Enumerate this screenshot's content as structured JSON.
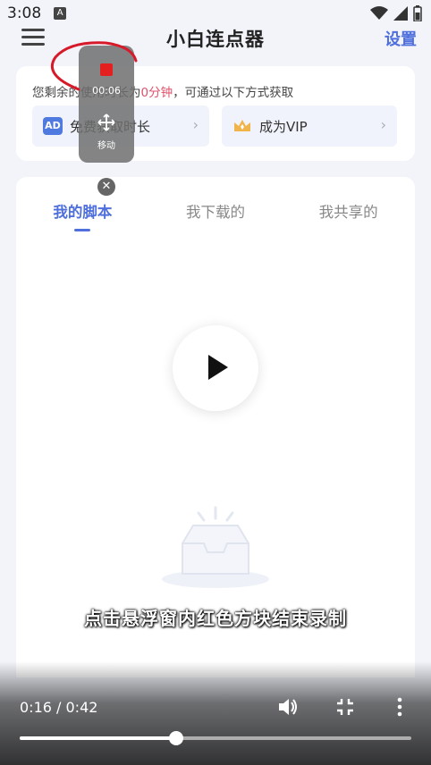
{
  "status_bar": {
    "time": "3:08",
    "a_badge": "A"
  },
  "header": {
    "title": "小白连点器",
    "settings_label": "设置"
  },
  "quota": {
    "text_prefix": "您剩余的使用时长为",
    "text_highlight": "0分钟",
    "text_suffix": "，可通过以下方式获取",
    "ad_badge": "AD",
    "ad_option": "免费获取时长",
    "vip_option": "成为VIP",
    "chevron": "›"
  },
  "tabs": [
    {
      "label": "我的脚本",
      "active": true
    },
    {
      "label": "我下载的",
      "active": false
    },
    {
      "label": "我共享的",
      "active": false
    }
  ],
  "floating_panel": {
    "timer": "00:06",
    "move_label": "移动",
    "close_symbol": "✕"
  },
  "caption": "点击悬浮窗内红色方块结束录制",
  "video_controls": {
    "time_display": "0:16 / 0:42",
    "progress": 0.4
  },
  "colors": {
    "accent": "#4f6fdc",
    "highlight": "#e0506a",
    "record": "#e41f1f"
  },
  "icons": [
    "menu-icon",
    "play-icon",
    "ad-icon",
    "crown-icon",
    "volume-icon",
    "fullscreen-exit-icon",
    "more-vert-icon",
    "move-icon",
    "close-icon",
    "empty-inbox-icon"
  ]
}
